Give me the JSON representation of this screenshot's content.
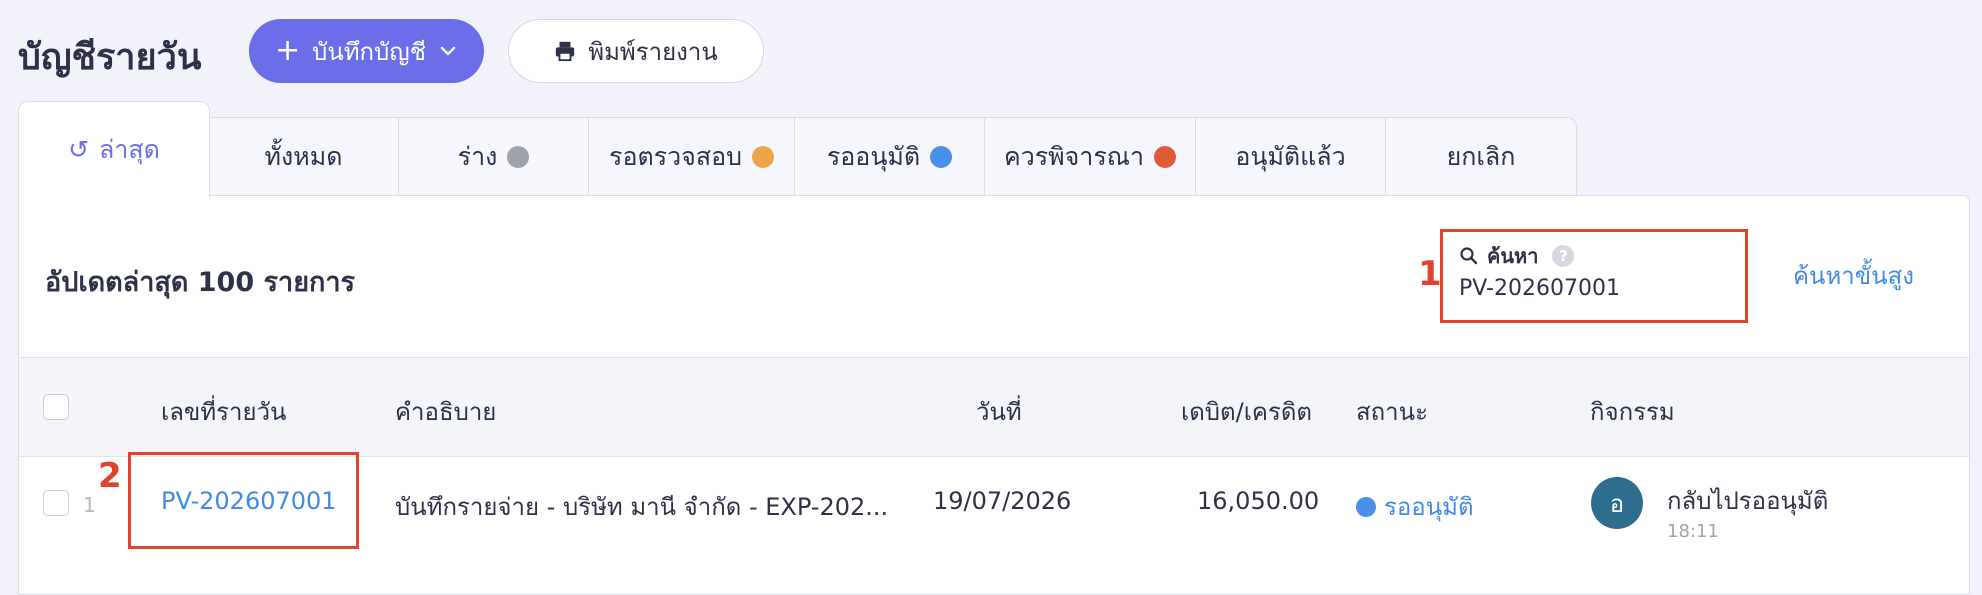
{
  "header": {
    "title": "บัญชีรายวัน",
    "record_button": {
      "plus": "+",
      "label": "บันทึกบัญชี"
    },
    "print_button": {
      "label": "พิมพ์รายงาน"
    }
  },
  "tabs": [
    {
      "icon": "↺",
      "label": "ล่าสุด",
      "active": true
    },
    {
      "label": "ทั้งหมด"
    },
    {
      "label": "ร่าง",
      "dot": "#a0a2ab"
    },
    {
      "label": "รอตรวจสอบ",
      "dot": "#f0a44a"
    },
    {
      "label": "รออนุมัติ",
      "dot": "#4a90e8"
    },
    {
      "label": "ควรพิจารณา",
      "dot": "#e05a3a"
    },
    {
      "label": "อนุมัติแล้ว"
    },
    {
      "label": "ยกเลิก"
    }
  ],
  "main": {
    "subtitle": "อัปเดตล่าสุด 100 รายการ",
    "search": {
      "label": "ค้นหา",
      "help": "?",
      "value": "PV-202607001"
    },
    "advanced_search": "ค้นหาขั้นสูง"
  },
  "table": {
    "columns": [
      "เลขที่รายวัน",
      "คำอธิบาย",
      "วันที่",
      "เดบิต/เครดิต",
      "สถานะ",
      "กิจกรรม"
    ],
    "rows": [
      {
        "index": "1",
        "number": "PV-202607001",
        "description": "บันทึกรายจ่าย - บริษัท มานี จำกัด - EXP-202...",
        "date": "19/07/2026",
        "amount": "16,050.00",
        "status": "รออนุมัติ",
        "activity": {
          "avatar": "อ",
          "text": "กลับไปรออนุมัติ",
          "time": "18:11"
        }
      }
    ]
  },
  "annotations": [
    "1",
    "2"
  ],
  "colors": {
    "accent": "#6c6ee9",
    "link": "#3f8be6",
    "annotation": "#e0432b"
  }
}
